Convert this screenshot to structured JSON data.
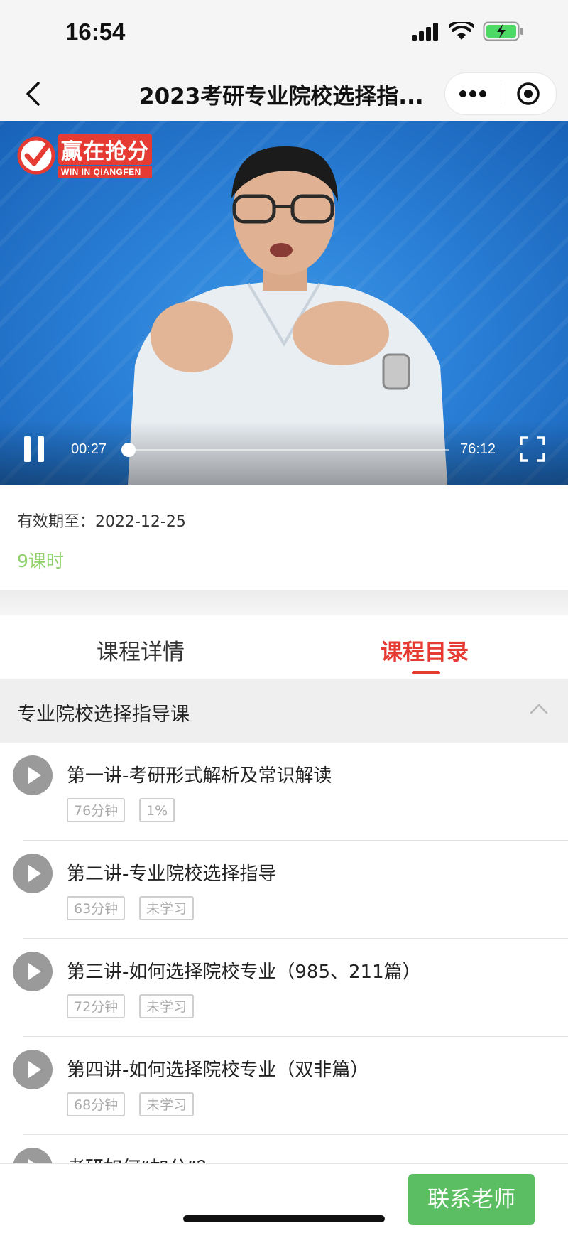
{
  "status_bar": {
    "time": "16:54"
  },
  "nav": {
    "title": "2023考研专业院校选择指..."
  },
  "video": {
    "logo_cn": "赢在抢分",
    "logo_en": "WIN IN QIANGFEN",
    "current_time": "00:27",
    "total_time": "76:12",
    "progress_fraction": 0.006
  },
  "info": {
    "validity": "有效期至：2022-12-25",
    "lessons_count": "9课时"
  },
  "tabs": {
    "detail": "课程详情",
    "catalog": "课程目录"
  },
  "section": {
    "title": "专业院校选择指导课"
  },
  "lessons": [
    {
      "title": "第一讲-考研形式解析及常识解读",
      "duration": "76分钟",
      "status": "1%"
    },
    {
      "title": "第二讲-专业院校选择指导",
      "duration": "63分钟",
      "status": "未学习"
    },
    {
      "title": "第三讲-如何选择院校专业（985、211篇）",
      "duration": "72分钟",
      "status": "未学习"
    },
    {
      "title": "第四讲-如何选择院校专业（双非篇）",
      "duration": "68分钟",
      "status": "未学习"
    },
    {
      "title": "考研如何“加分”？"
    }
  ],
  "bottom": {
    "contact_label": "联系老师"
  },
  "colors": {
    "accent": "#e63b32",
    "green": "#5cbe62",
    "lessons_green": "#8fd16a"
  }
}
